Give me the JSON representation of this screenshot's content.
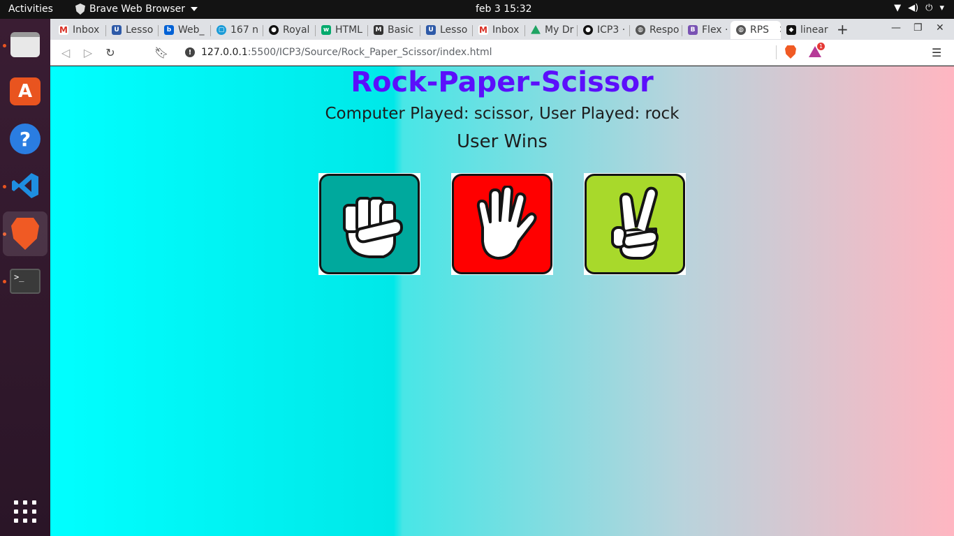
{
  "topbar": {
    "activities": "Activities",
    "app_name": "Brave Web Browser",
    "clock": "feb 3  15:32"
  },
  "dock": {
    "items": [
      "files-icon",
      "software-store-icon",
      "help-icon",
      "vscode-icon",
      "brave-icon",
      "terminal-icon",
      "show-apps-icon"
    ]
  },
  "browser": {
    "tabs": [
      {
        "label": "Inbox",
        "icon": "gmail-icon",
        "color": "#d93025"
      },
      {
        "label": "Lesso",
        "icon": "umkc-icon",
        "color": "#2e5aa8"
      },
      {
        "label": "Web_",
        "icon": "box-icon",
        "color": "#0061d5"
      },
      {
        "label": "167 n",
        "icon": "chat-icon",
        "color": "#1a9bd7"
      },
      {
        "label": "Royal",
        "icon": "github-icon",
        "color": "#111111"
      },
      {
        "label": "HTML",
        "icon": "w3schools-icon",
        "color": "#04aa6d"
      },
      {
        "label": "Basic",
        "icon": "markdown-icon",
        "color": "#333333"
      },
      {
        "label": "Lesso",
        "icon": "umkc-icon",
        "color": "#2e5aa8"
      },
      {
        "label": "Inbox",
        "icon": "gmail-icon",
        "color": "#d93025"
      },
      {
        "label": "My Dr",
        "icon": "drive-icon",
        "color": "#1fa463"
      },
      {
        "label": "ICP3 ·",
        "icon": "github-icon",
        "color": "#111111"
      },
      {
        "label": "Respo",
        "icon": "globe-icon",
        "color": "#555555"
      },
      {
        "label": "Flex · I",
        "icon": "bootstrap-icon",
        "color": "#7952b3"
      },
      {
        "label": "RPS",
        "icon": "globe-icon",
        "color": "#555555"
      },
      {
        "label": "linear",
        "icon": "page-icon",
        "color": "#111111"
      }
    ],
    "url_host": "127.0.0.1",
    "url_path": ":5500/ICP3/Source/Rock_Paper_Scissor/index.html",
    "rewards_badge": "1"
  },
  "page": {
    "title": "Rock-Paper-Scissor",
    "result": "Computer Played: scissor, User Played: rock",
    "winner": "User Wins",
    "choices": [
      {
        "name": "rock",
        "color": "#00a99d"
      },
      {
        "name": "paper",
        "color": "#ff0000"
      },
      {
        "name": "scissor",
        "color": "#a8d92b"
      }
    ]
  },
  "colors": {
    "title": "#5b0ffb",
    "gradient_start": "#00ffff",
    "gradient_end": "#ffb6c1"
  }
}
